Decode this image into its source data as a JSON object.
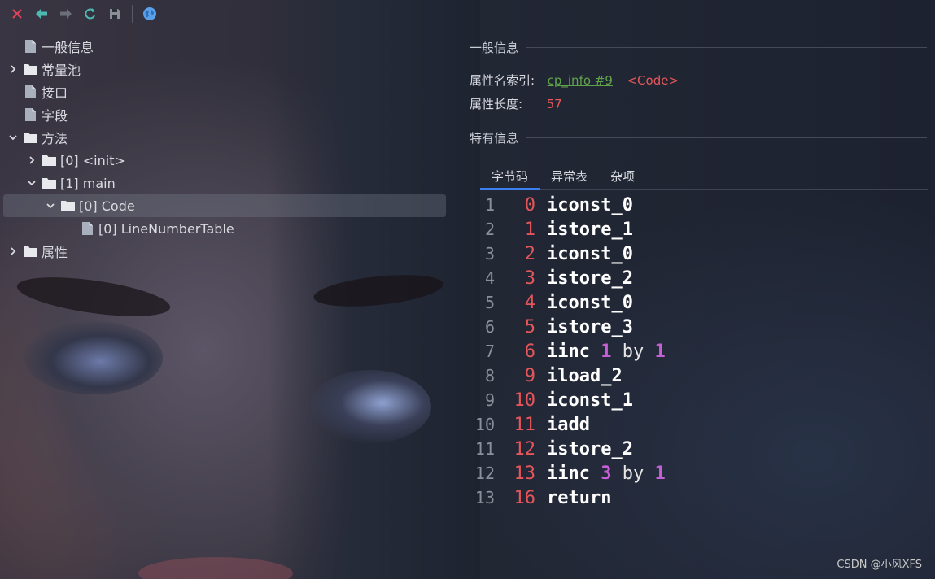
{
  "toolbar": {
    "buttons": [
      {
        "icon": "close-icon",
        "color": "#e5435a"
      },
      {
        "icon": "back-arrow-icon",
        "color": "#4fb8b0"
      },
      {
        "icon": "forward-arrow-icon",
        "color": "#6b6f78"
      },
      {
        "icon": "refresh-icon",
        "color": "#4fb8b0"
      },
      {
        "icon": "save-icon",
        "color": "#8a8e97"
      },
      {
        "icon": "globe-icon",
        "color": "#5aa0e8"
      }
    ]
  },
  "tree": {
    "items": [
      {
        "label": "一般信息",
        "depth": 0,
        "chevron": "none",
        "icon": "file-icon"
      },
      {
        "label": "常量池",
        "depth": 0,
        "chevron": "right",
        "icon": "folder-icon"
      },
      {
        "label": "接口",
        "depth": 0,
        "chevron": "none",
        "icon": "file-icon"
      },
      {
        "label": "字段",
        "depth": 0,
        "chevron": "none",
        "icon": "file-icon"
      },
      {
        "label": "方法",
        "depth": 0,
        "chevron": "down",
        "icon": "folder-icon"
      },
      {
        "label": "[0] <init>",
        "depth": 1,
        "chevron": "right",
        "icon": "folder-icon"
      },
      {
        "label": "[1] main",
        "depth": 1,
        "chevron": "down",
        "icon": "folder-icon"
      },
      {
        "label": "[0] Code",
        "depth": 2,
        "chevron": "down",
        "icon": "folder-icon",
        "selected": true
      },
      {
        "label": "[0] LineNumberTable",
        "depth": 3,
        "chevron": "none",
        "icon": "file-icon"
      },
      {
        "label": "属性",
        "depth": 0,
        "chevron": "right",
        "icon": "folder-icon"
      }
    ]
  },
  "general": {
    "title": "一般信息",
    "name_index_label": "属性名索引:",
    "name_index_link": "cp_info #9",
    "name_index_value": "<Code>",
    "length_label": "属性长度:",
    "length_value": "57"
  },
  "specific": {
    "title": "特有信息",
    "tabs": [
      "字节码",
      "异常表",
      "杂项"
    ],
    "active_tab": 0
  },
  "code": [
    {
      "line": "1",
      "offset": "0",
      "op": "iconst_0"
    },
    {
      "line": "2",
      "offset": "1",
      "op": "istore_1"
    },
    {
      "line": "3",
      "offset": "2",
      "op": "iconst_0"
    },
    {
      "line": "4",
      "offset": "3",
      "op": "istore_2"
    },
    {
      "line": "5",
      "offset": "4",
      "op": "iconst_0"
    },
    {
      "line": "6",
      "offset": "5",
      "op": "istore_3"
    },
    {
      "line": "7",
      "offset": "6",
      "op": "iinc",
      "a": "1",
      "by": "by",
      "b": "1"
    },
    {
      "line": "8",
      "offset": "9",
      "op": "iload_2"
    },
    {
      "line": "9",
      "offset": "10",
      "op": "iconst_1"
    },
    {
      "line": "10",
      "offset": "11",
      "op": "iadd"
    },
    {
      "line": "11",
      "offset": "12",
      "op": "istore_2"
    },
    {
      "line": "12",
      "offset": "13",
      "op": "iinc",
      "a": "3",
      "by": "by",
      "b": "1"
    },
    {
      "line": "13",
      "offset": "16",
      "op": "return"
    }
  ],
  "watermark": "CSDN @小风XFS"
}
